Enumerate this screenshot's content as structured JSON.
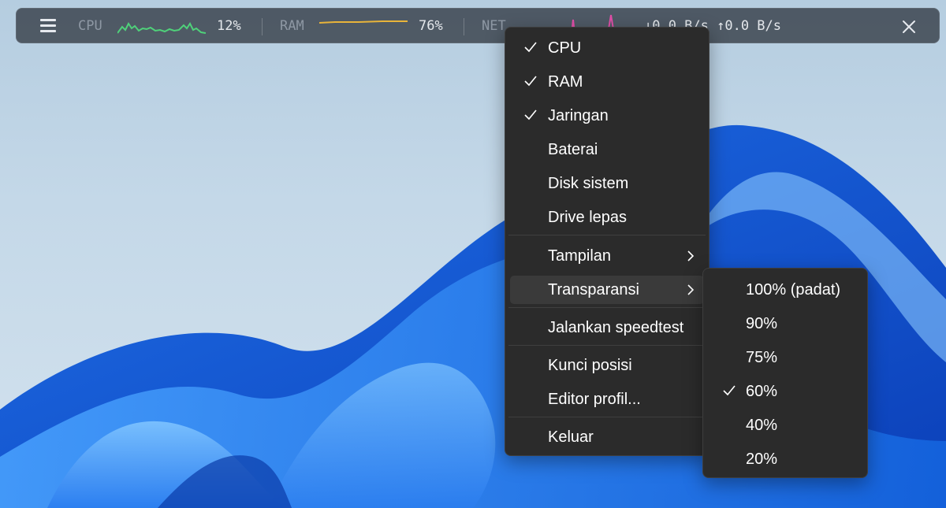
{
  "bar": {
    "cpu_label": "CPU",
    "cpu_value": "12%",
    "ram_label": "RAM",
    "ram_value": "76%",
    "net_label": "NET",
    "net_value": "↓0.0 B/s ↑0.0 B/s",
    "cpu_color": "#4fd17a",
    "ram_color": "#e8b43a",
    "net_color": "#e04fa8"
  },
  "menu": {
    "items": [
      {
        "label": "CPU",
        "checked": true
      },
      {
        "label": "RAM",
        "checked": true
      },
      {
        "label": "Jaringan",
        "checked": true
      },
      {
        "label": "Baterai",
        "checked": false
      },
      {
        "label": "Disk sistem",
        "checked": false
      },
      {
        "label": "Drive lepas",
        "checked": false
      },
      {
        "label": "Tampilan",
        "submenu": true
      },
      {
        "label": "Transparansi",
        "submenu": true,
        "highlighted": true
      },
      {
        "label": "Jalankan speedtest"
      },
      {
        "label": "Kunci posisi"
      },
      {
        "label": "Editor profil..."
      },
      {
        "label": "Keluar"
      }
    ]
  },
  "transparency_submenu": {
    "items": [
      {
        "label": "100% (padat)",
        "checked": false
      },
      {
        "label": "90%",
        "checked": false
      },
      {
        "label": "75%",
        "checked": false
      },
      {
        "label": "60%",
        "checked": true
      },
      {
        "label": "40%",
        "checked": false
      },
      {
        "label": "20%",
        "checked": false
      }
    ]
  }
}
